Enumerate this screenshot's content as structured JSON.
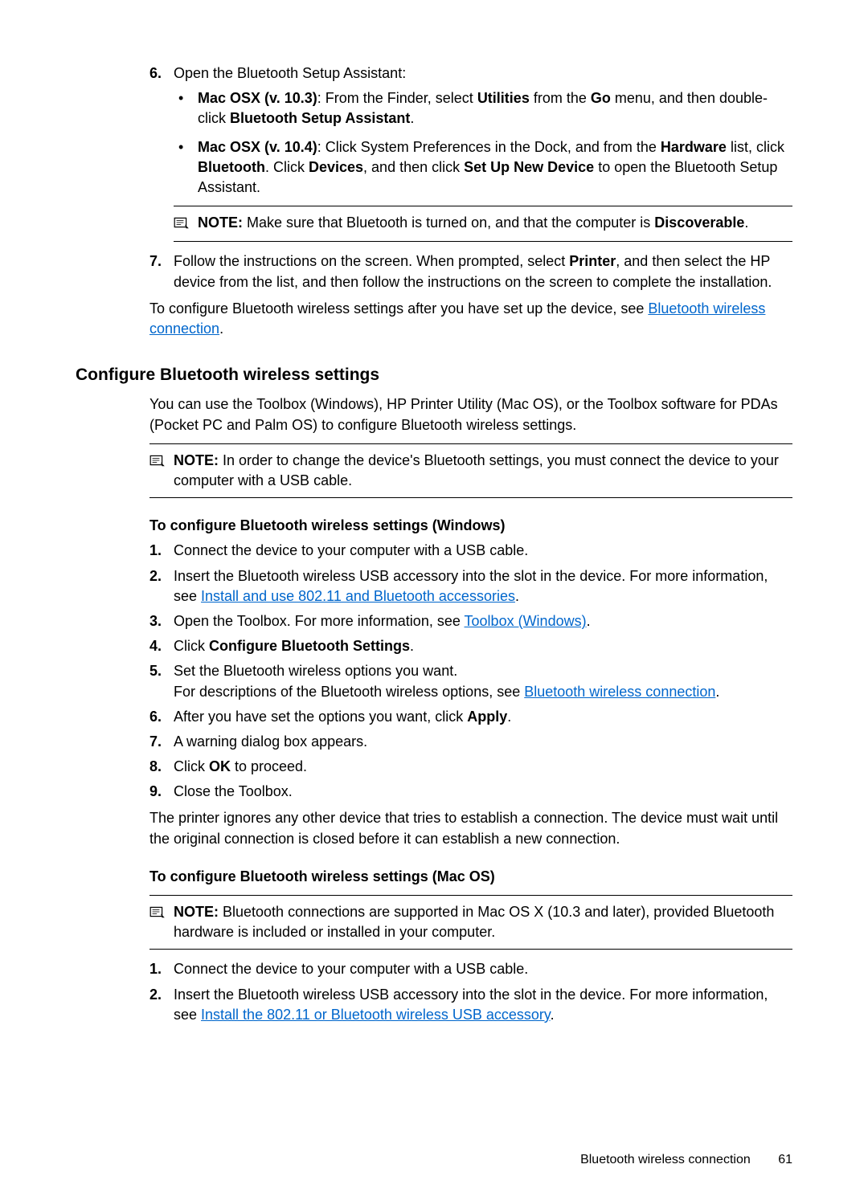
{
  "step6": {
    "num": "6.",
    "text": "Open the Bluetooth Setup Assistant:",
    "bullets": [
      {
        "pre": "Mac OSX (v. 10.3)",
        "mid1": ": From the Finder, select ",
        "b1": "Utilities",
        "mid2": " from the ",
        "b2": "Go",
        "mid3": " menu, and then double-click ",
        "b3": "Bluetooth Setup Assistant",
        "tail": "."
      },
      {
        "pre": "Mac OSX (v. 10.4)",
        "mid1": ": Click System Preferences in the Dock, and from the ",
        "b1": "Hardware",
        "mid2": " list, click ",
        "b2": "Bluetooth",
        "mid3": ". Click ",
        "b3": "Devices",
        "mid4": ", and then click ",
        "b4": "Set Up New Device",
        "tail": " to open the Bluetooth Setup Assistant."
      }
    ],
    "note": {
      "label": "NOTE:",
      "t1": "  Make sure that Bluetooth is turned on, and that the computer is ",
      "b": "Discoverable",
      "t2": "."
    }
  },
  "step7": {
    "num": "7.",
    "t1": "Follow the instructions on the screen. When prompted, select ",
    "b1": "Printer",
    "t2": ", and then select the HP device from the list, and then follow the instructions on the screen to complete the installation."
  },
  "after7": {
    "t1": "To configure Bluetooth wireless settings after you have set up the device, see ",
    "link": "Bluetooth wireless connection",
    "t2": "."
  },
  "h2": "Configure Bluetooth wireless settings",
  "intro": "You can use the Toolbox (Windows), HP Printer Utility (Mac OS), or the Toolbox software for PDAs (Pocket PC and Palm OS) to configure Bluetooth wireless settings.",
  "note_main": {
    "label": "NOTE:",
    "t": "  In order to change the device's Bluetooth settings, you must connect the device to your computer with a USB cable."
  },
  "win": {
    "head": "To configure Bluetooth wireless settings (Windows)",
    "steps": {
      "s1": {
        "n": "1.",
        "t": "Connect the device to your computer with a USB cable."
      },
      "s2": {
        "n": "2.",
        "t1": "Insert the Bluetooth wireless USB accessory into the slot in the device. For more information, see ",
        "link": "Install and use 802.11 and Bluetooth accessories",
        "t2": "."
      },
      "s3": {
        "n": "3.",
        "t1": "Open the Toolbox. For more information, see ",
        "link": "Toolbox (Windows)",
        "t2": "."
      },
      "s4": {
        "n": "4.",
        "t1": "Click ",
        "b": "Configure Bluetooth Settings",
        "t2": "."
      },
      "s5": {
        "n": "5.",
        "line1": "Set the Bluetooth wireless options you want.",
        "line2a": "For descriptions of the Bluetooth wireless options, see ",
        "link": "Bluetooth wireless connection",
        "line2b": "."
      },
      "s6": {
        "n": "6.",
        "t1": "After you have set the options you want, click ",
        "b": "Apply",
        "t2": "."
      },
      "s7": {
        "n": "7.",
        "t": "A warning dialog box appears."
      },
      "s8": {
        "n": "8.",
        "t1": "Click ",
        "b": "OK",
        "t2": " to proceed."
      },
      "s9": {
        "n": "9.",
        "t": "Close the Toolbox."
      }
    },
    "after": "The printer ignores any other device that tries to establish a connection. The device must wait until the original connection is closed before it can establish a new connection."
  },
  "mac": {
    "head": "To configure Bluetooth wireless settings (Mac OS)",
    "note": {
      "label": "NOTE:",
      "t": "  Bluetooth connections are supported in Mac OS X (10.3 and later), provided Bluetooth hardware is included or installed in your computer."
    },
    "s1": {
      "n": "1.",
      "t": "Connect the device to your computer with a USB cable."
    },
    "s2": {
      "n": "2.",
      "t1": "Insert the Bluetooth wireless USB accessory into the slot in the device. For more information, see ",
      "link": "Install the 802.11 or Bluetooth wireless USB accessory",
      "t2": "."
    }
  },
  "footer": {
    "title": "Bluetooth wireless connection",
    "page": "61"
  }
}
